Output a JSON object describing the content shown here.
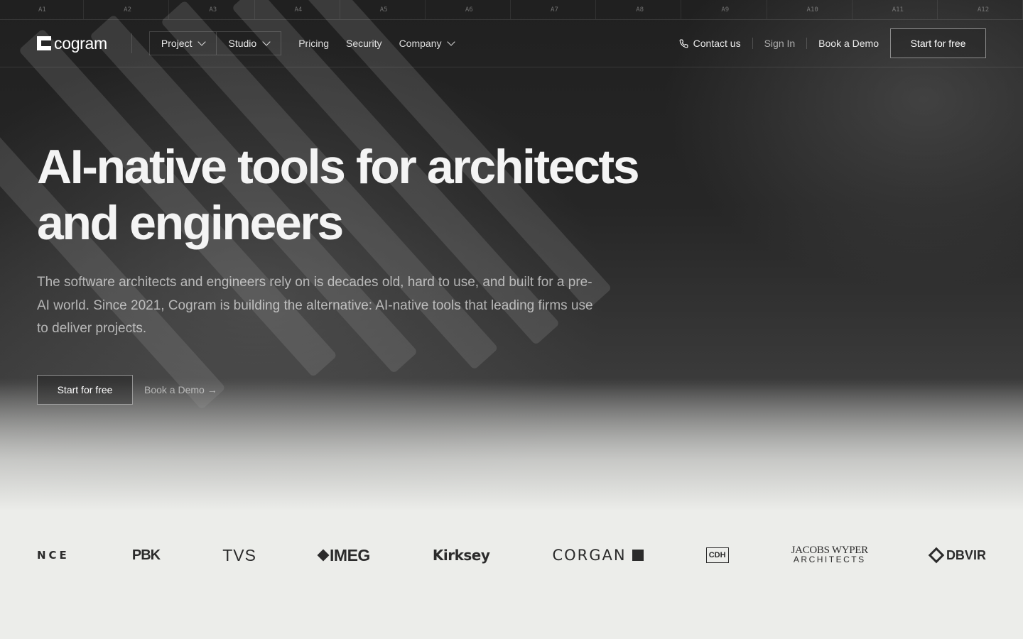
{
  "ruler": [
    "A1",
    "A2",
    "A3",
    "A4",
    "A5",
    "A6",
    "A7",
    "A8",
    "A9",
    "A10",
    "A11",
    "A12"
  ],
  "brand": {
    "name": "cogram"
  },
  "nav": {
    "project": "Project",
    "studio": "Studio",
    "pricing": "Pricing",
    "security": "Security",
    "company": "Company",
    "contact": "Contact us",
    "sign_in": "Sign In",
    "book_demo": "Book a Demo",
    "start": "Start for free"
  },
  "hero": {
    "headline_1": "AI-native tools for architects",
    "headline_2": "and engineers",
    "subhead": "The software architects and engineers rely on is decades old, hard to use, and built for a pre-AI world. Since 2021, Cogram is building the alternative: AI-native tools that leading firms use to deliver projects.",
    "cta_primary": "Start for free",
    "cta_secondary": "Book a Demo →"
  },
  "logos": {
    "l1": "NCE",
    "l2": "PBK",
    "l3": "TVS",
    "l4": "IMEG",
    "l5": "Kirksey",
    "l6": "CORGAN",
    "l7": "CDH",
    "l8a": "JACOBS WYPER",
    "l8b": "ARCHITECTS",
    "l9": "DBVIR"
  },
  "colors": {
    "hero_dark": "#262626",
    "page_bg": "#ecedea",
    "logo_ink": "#2b2b2b"
  }
}
